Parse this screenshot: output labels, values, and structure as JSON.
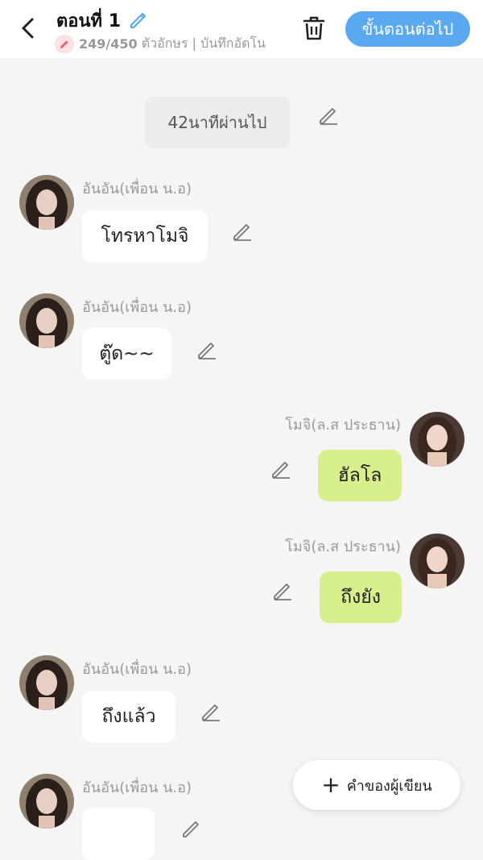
{
  "header": {
    "title": "ตอนที่ 1",
    "char_count": "249/450",
    "subtitle_rest": "ตัวอักษร | บันทึกอัตโน",
    "next_label": "ขั้นตอนต่อไป"
  },
  "timestamp": "42นาทีผ่านไป",
  "messages": [
    {
      "sender": "อันอัน(เพื่อน น.อ)",
      "text": "โทรหาโมจิ",
      "side": "left"
    },
    {
      "sender": "อันอัน(เพื่อน น.อ)",
      "text": "ตู๊ด~~",
      "side": "left"
    },
    {
      "sender": "โมจิ(ล.ส ประธาน)",
      "text": "ฮัลโล",
      "side": "right"
    },
    {
      "sender": "โมจิ(ล.ส ประธาน)",
      "text": "ถึงยัง",
      "side": "right"
    },
    {
      "sender": "อันอัน(เพื่อน น.อ)",
      "text": "ถึงแล้ว",
      "side": "left"
    },
    {
      "sender": "อันอัน(เพื่อน น.อ)",
      "text": "",
      "side": "left"
    }
  ],
  "fab_label": "คำของผู้เขียน",
  "colors": {
    "accent": "#5aa8ef",
    "right_bubble": "#d8f08c",
    "left_bubble": "#ffffff",
    "background": "#f5f5f5"
  },
  "icons": {
    "back": "chevron-left-icon",
    "title_edit": "pencil-icon",
    "trash": "trash-icon",
    "message_edit": "pencil-icon",
    "fab": "plus-icon"
  }
}
